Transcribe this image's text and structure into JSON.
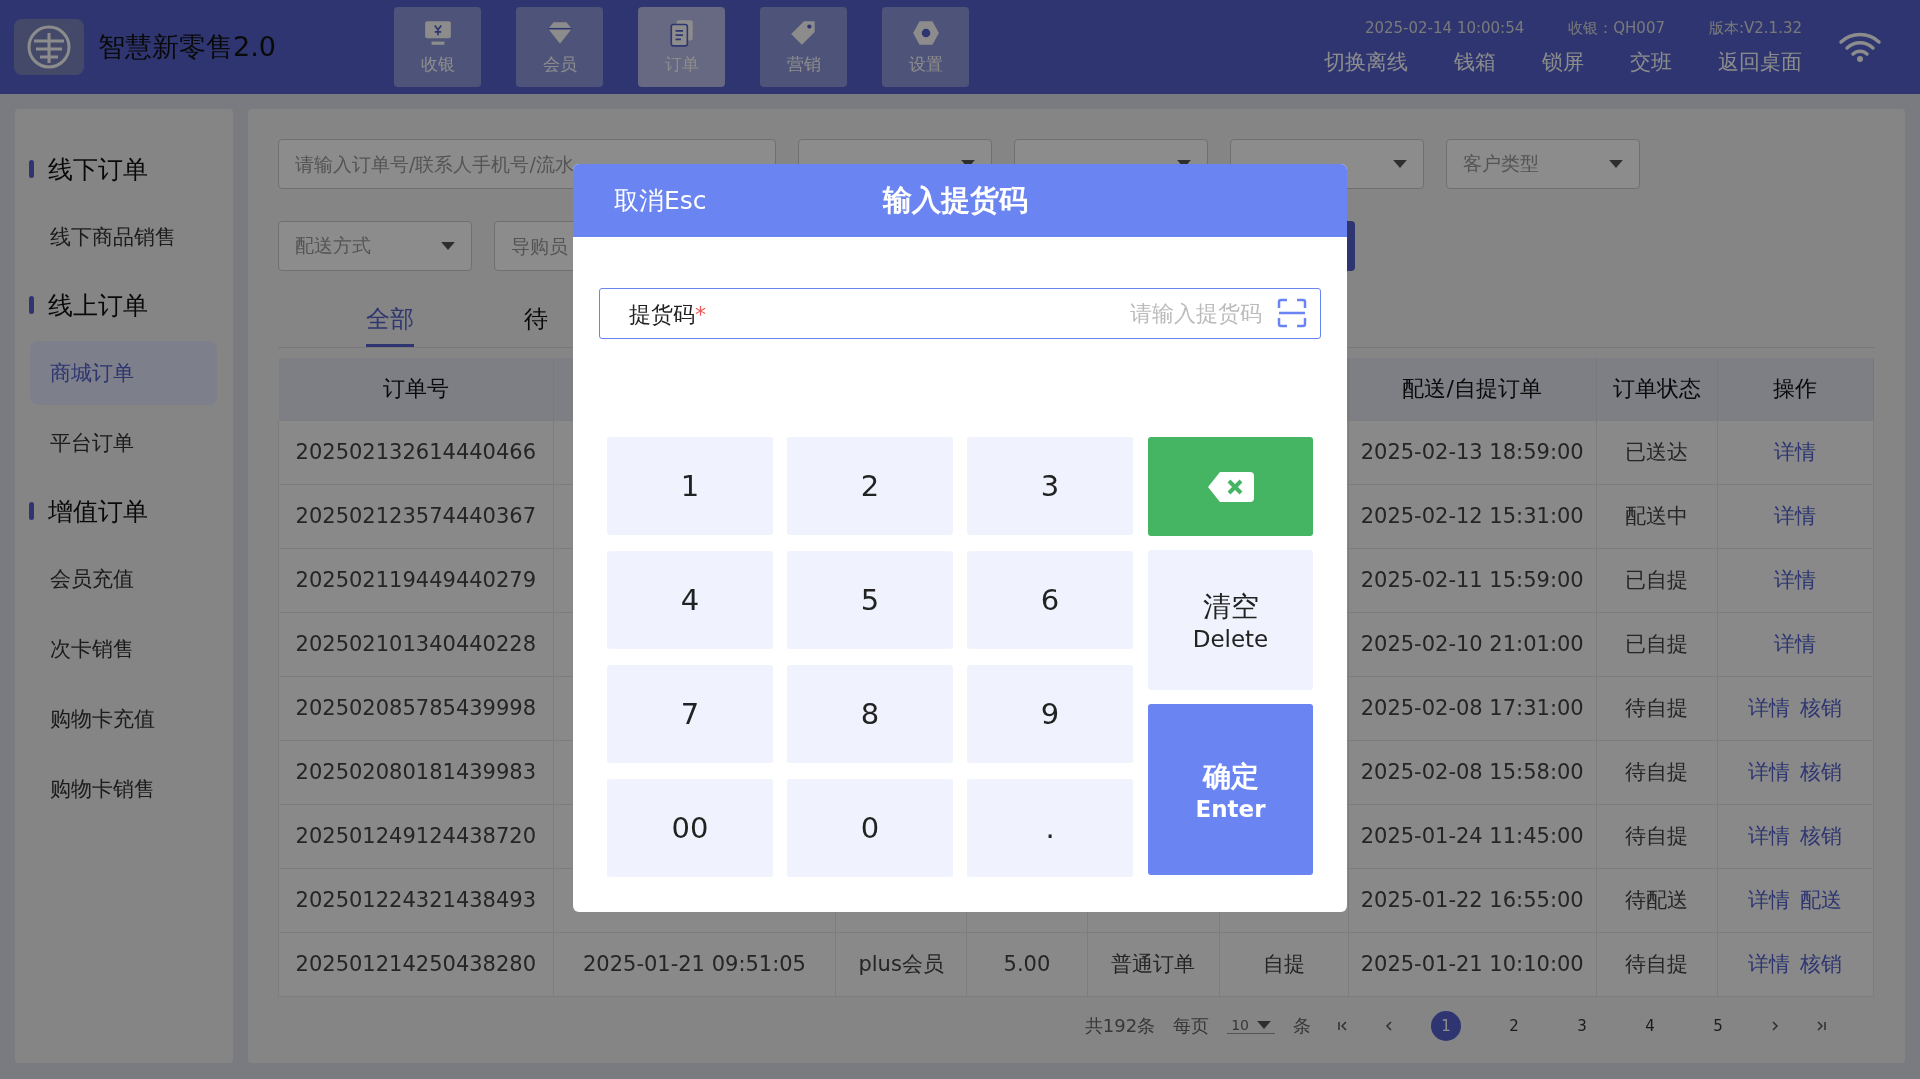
{
  "header": {
    "title": "智慧新零售2.0",
    "nav": [
      {
        "label": "收银",
        "selected": false
      },
      {
        "label": "会员",
        "selected": false
      },
      {
        "label": "订单",
        "selected": true
      },
      {
        "label": "营销",
        "selected": false
      },
      {
        "label": "设置",
        "selected": false
      }
    ],
    "datetime": "2025-02-14 10:00:54",
    "cashier": "收银：QH007",
    "version": "版本:V2.1.32",
    "links": [
      "切换离线",
      "钱箱",
      "锁屏",
      "交班",
      "返回桌面"
    ]
  },
  "sidebar": {
    "groups": [
      {
        "label": "线下订单",
        "children": [
          {
            "label": "线下商品销售",
            "selected": false
          }
        ]
      },
      {
        "label": "线上订单",
        "children": [
          {
            "label": "商城订单",
            "selected": true
          },
          {
            "label": "平台订单",
            "selected": false
          }
        ]
      },
      {
        "label": "增值订单",
        "children": [
          {
            "label": "会员充值",
            "selected": false
          },
          {
            "label": "次卡销售",
            "selected": false
          },
          {
            "label": "购物卡充值",
            "selected": false
          },
          {
            "label": "购物卡销售",
            "selected": false
          }
        ]
      }
    ]
  },
  "filters": {
    "search": {
      "placeholder": "请输入订单号/联系人手机号/流水"
    },
    "selects": [
      "客户类型"
    ],
    "delivery_select": "配送方式",
    "salesperson": {
      "placeholder": "导购员"
    }
  },
  "tabs": [
    {
      "label": "全部",
      "selected": true
    },
    {
      "label": "待",
      "selected": false
    }
  ],
  "table": {
    "columns": [
      "订单号",
      null,
      null,
      null,
      null,
      null,
      "配送/自提订单",
      "订单状态",
      "操作"
    ],
    "rows": [
      {
        "cells": [
          "202502132614440466",
          null,
          null,
          null,
          null,
          null,
          "2025-02-13 18:59:00",
          "已送达"
        ],
        "actions": [
          "详情"
        ]
      },
      {
        "cells": [
          "202502123574440367",
          null,
          null,
          null,
          null,
          null,
          "2025-02-12 15:31:00",
          "配送中"
        ],
        "actions": [
          "详情"
        ]
      },
      {
        "cells": [
          "202502119449440279",
          null,
          null,
          null,
          null,
          null,
          "2025-02-11 15:59:00",
          "已自提"
        ],
        "actions": [
          "详情"
        ]
      },
      {
        "cells": [
          "202502101340440228",
          null,
          null,
          null,
          null,
          null,
          "2025-02-10 21:01:00",
          "已自提"
        ],
        "actions": [
          "详情"
        ]
      },
      {
        "cells": [
          "202502085785439998",
          null,
          null,
          null,
          null,
          null,
          "2025-02-08 17:31:00",
          "待自提"
        ],
        "actions": [
          "详情",
          "核销"
        ]
      },
      {
        "cells": [
          "202502080181439983",
          null,
          null,
          null,
          null,
          null,
          "2025-02-08 15:58:00",
          "待自提"
        ],
        "actions": [
          "详情",
          "核销"
        ]
      },
      {
        "cells": [
          "202501249124438720",
          null,
          null,
          null,
          null,
          null,
          "2025-01-24 11:45:00",
          "待自提"
        ],
        "actions": [
          "详情",
          "核销"
        ]
      },
      {
        "cells": [
          "202501224321438493",
          null,
          null,
          null,
          null,
          null,
          "2025-01-22 16:55:00",
          "待配送"
        ],
        "actions": [
          "详情",
          "配送"
        ]
      },
      {
        "cells": [
          "202501214250438280",
          "2025-01-21 09:51:05",
          "plus会员",
          "5.00",
          "普通订单",
          "自提",
          "2025-01-21 10:10:00",
          "待自提"
        ],
        "actions": [
          "详情",
          "核销"
        ]
      }
    ]
  },
  "pagination": {
    "total": "共192条",
    "per_page_label": "每页",
    "per_page": "10",
    "unit": "条",
    "pages": [
      {
        "label": "1",
        "selected": true
      },
      {
        "label": "2",
        "selected": false
      },
      {
        "label": "3",
        "selected": false
      },
      {
        "label": "4",
        "selected": false
      },
      {
        "label": "5",
        "selected": false
      }
    ]
  },
  "modal": {
    "cancel": "取消Esc",
    "title": "输入提货码",
    "field": {
      "label": "提货码",
      "required_mark": "*",
      "placeholder": "请输入提货码"
    },
    "digits": [
      "1",
      "2",
      "3",
      "4",
      "5",
      "6",
      "7",
      "8",
      "9",
      "00",
      "0",
      "."
    ],
    "actions": [
      {
        "kind": "backspace"
      },
      {
        "kind": "clear",
        "label": "清空",
        "sublabel": "Delete"
      },
      {
        "kind": "confirm",
        "label": "确定",
        "sublabel": "Enter"
      }
    ]
  }
}
